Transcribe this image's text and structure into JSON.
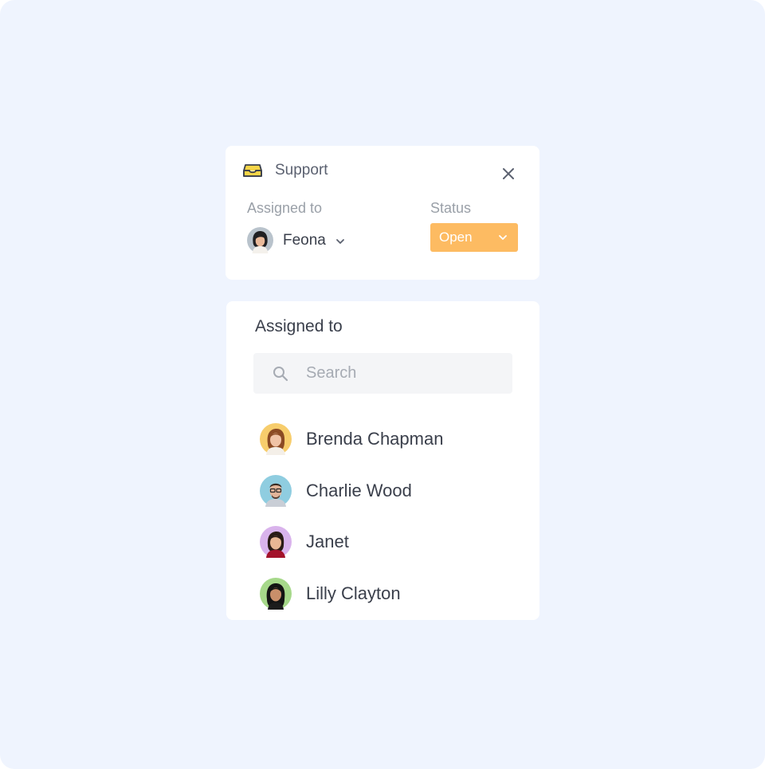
{
  "ticket": {
    "inbox_icon": "inbox-tray-icon",
    "title": "Support",
    "close_icon": "close-icon",
    "assigned_label": "Assigned to",
    "assignee_name": "Feona",
    "status_label": "Status",
    "status_value": "Open",
    "status_color": "#fdbb62"
  },
  "assign_panel": {
    "title": "Assigned to",
    "search_placeholder": "Search",
    "search_value": "",
    "people": [
      {
        "name": "Brenda Chapman",
        "avatar_bg": "#f7cd6c"
      },
      {
        "name": "Charlie Wood",
        "avatar_bg": "#8fcde0"
      },
      {
        "name": "Janet",
        "avatar_bg": "#d9b3ec"
      },
      {
        "name": "Lilly Clayton",
        "avatar_bg": "#a6d88a"
      }
    ]
  },
  "colors": {
    "background": "#eff4fe",
    "card": "#ffffff",
    "accent_yellow": "#f6d548"
  }
}
